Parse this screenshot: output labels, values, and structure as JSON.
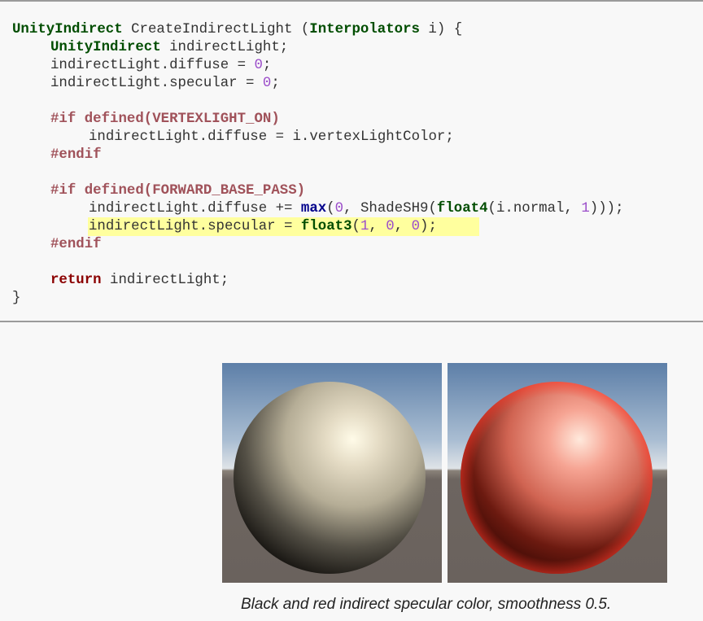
{
  "code": {
    "lines": [
      {
        "indent": 0,
        "tokens": [
          {
            "t": "UnityIndirect",
            "c": "type"
          },
          {
            "t": " CreateIndirectLight (",
            "c": "plain"
          },
          {
            "t": "Interpolators",
            "c": "type"
          },
          {
            "t": " i) {",
            "c": "plain"
          }
        ]
      },
      {
        "indent": 1,
        "tokens": [
          {
            "t": "UnityIndirect",
            "c": "type"
          },
          {
            "t": " indirectLight;",
            "c": "plain"
          }
        ]
      },
      {
        "indent": 1,
        "tokens": [
          {
            "t": "indirectLight.diffuse = ",
            "c": "plain"
          },
          {
            "t": "0",
            "c": "num"
          },
          {
            "t": ";",
            "c": "plain"
          }
        ]
      },
      {
        "indent": 1,
        "tokens": [
          {
            "t": "indirectLight.specular = ",
            "c": "plain"
          },
          {
            "t": "0",
            "c": "num"
          },
          {
            "t": ";",
            "c": "plain"
          }
        ]
      },
      {
        "indent": 0,
        "tokens": []
      },
      {
        "indent": 1,
        "tokens": [
          {
            "t": "#if defined(VERTEXLIGHT_ON)",
            "c": "pre"
          }
        ]
      },
      {
        "indent": 2,
        "tokens": [
          {
            "t": "indirectLight.diffuse = i.vertexLightColor;",
            "c": "plain"
          }
        ]
      },
      {
        "indent": 1,
        "tokens": [
          {
            "t": "#endif",
            "c": "pre"
          }
        ]
      },
      {
        "indent": 0,
        "tokens": []
      },
      {
        "indent": 1,
        "tokens": [
          {
            "t": "#if defined(FORWARD_BASE_PASS)",
            "c": "pre"
          }
        ]
      },
      {
        "indent": 2,
        "tokens": [
          {
            "t": "indirectLight.diffuse += ",
            "c": "plain"
          },
          {
            "t": "max",
            "c": "fn"
          },
          {
            "t": "(",
            "c": "plain"
          },
          {
            "t": "0",
            "c": "num"
          },
          {
            "t": ", ShadeSH9(",
            "c": "plain"
          },
          {
            "t": "float4",
            "c": "type"
          },
          {
            "t": "(i.normal, ",
            "c": "plain"
          },
          {
            "t": "1",
            "c": "num"
          },
          {
            "t": ")));",
            "c": "plain"
          }
        ]
      },
      {
        "indent": 2,
        "highlight": true,
        "tokens": [
          {
            "t": "indirectLight.specular = ",
            "c": "plain"
          },
          {
            "t": "float3",
            "c": "type"
          },
          {
            "t": "(",
            "c": "plain"
          },
          {
            "t": "1",
            "c": "num"
          },
          {
            "t": ", ",
            "c": "plain"
          },
          {
            "t": "0",
            "c": "num"
          },
          {
            "t": ", ",
            "c": "plain"
          },
          {
            "t": "0",
            "c": "num"
          },
          {
            "t": ");",
            "c": "plain"
          }
        ]
      },
      {
        "indent": 1,
        "tokens": [
          {
            "t": "#endif",
            "c": "pre"
          }
        ]
      },
      {
        "indent": 0,
        "tokens": []
      },
      {
        "indent": 1,
        "tokens": [
          {
            "t": "return",
            "c": "kw"
          },
          {
            "t": " indirectLight;",
            "c": "plain"
          }
        ]
      },
      {
        "indent": 0,
        "tokens": [
          {
            "t": "}",
            "c": "plain"
          }
        ]
      }
    ]
  },
  "figures": [
    {
      "name": "black-specular-sphere",
      "sphere_color": "#c8bfa6",
      "shadow_color": "#0a0806",
      "highlight_color": "#fffbe8"
    },
    {
      "name": "red-specular-sphere",
      "sphere_color": "#f28d7a",
      "shadow_color": "#2b0300",
      "highlight_color": "#ffe9dc"
    }
  ],
  "colors": {
    "sky_top": "#5d7fa8",
    "sky_horizon": "#d6dce3",
    "ground": "#6d6560",
    "highlight_line": "#ffff9e"
  },
  "caption": "Black and red indirect specular color, smoothness 0.5."
}
